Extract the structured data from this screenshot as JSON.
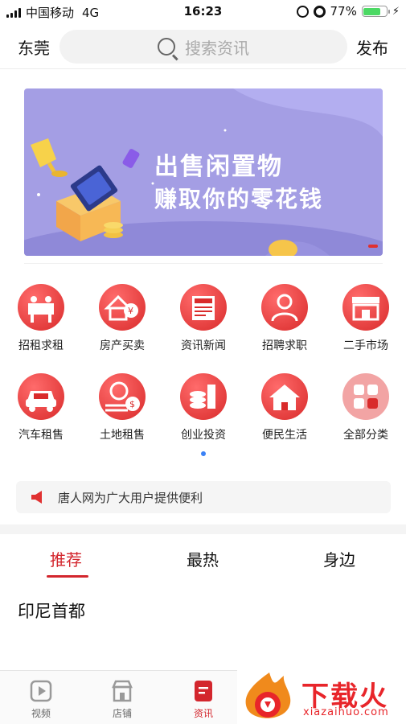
{
  "status_bar": {
    "carrier": "中国移动",
    "network": "4G",
    "time": "16:23",
    "battery": "77%",
    "battery_level": 0.77
  },
  "header": {
    "city": "东莞",
    "search_placeholder": "搜索资讯",
    "publish": "发布"
  },
  "banner": {
    "headline": "出售闲置物",
    "subline": "赚取你的零花钱"
  },
  "categories": [
    {
      "label": "招租求租",
      "icon": "handshake-icon"
    },
    {
      "label": "房产买卖",
      "icon": "house-yuan-icon"
    },
    {
      "label": "资讯新闻",
      "icon": "newspaper-icon"
    },
    {
      "label": "招聘求职",
      "icon": "person-icon"
    },
    {
      "label": "二手市场",
      "icon": "shop-icon"
    },
    {
      "label": "汽车租售",
      "icon": "car-icon"
    },
    {
      "label": "土地租售",
      "icon": "land-dollar-icon"
    },
    {
      "label": "创业投资",
      "icon": "coins-icon"
    },
    {
      "label": "便民生活",
      "icon": "home-icon"
    },
    {
      "label": "全部分类",
      "icon": "grid-icon"
    }
  ],
  "notice": {
    "text": "唐人网为广大用户提供便利"
  },
  "tabs": [
    {
      "label": "推荐",
      "active": true
    },
    {
      "label": "最热",
      "active": false
    },
    {
      "label": "身边",
      "active": false
    }
  ],
  "article": {
    "title": "印尼首都"
  },
  "bottom_nav": [
    {
      "label": "视频",
      "icon": "video-icon"
    },
    {
      "label": "店铺",
      "icon": "store-icon"
    },
    {
      "label": "资讯",
      "icon": "news-icon",
      "active": true
    }
  ],
  "watermark": {
    "brand": "下载火",
    "domain": "xiazaihuo.com"
  },
  "colors": {
    "accent": "#d3262d",
    "banner_bg": "#a49ee4",
    "icon_red": "#e03131"
  }
}
